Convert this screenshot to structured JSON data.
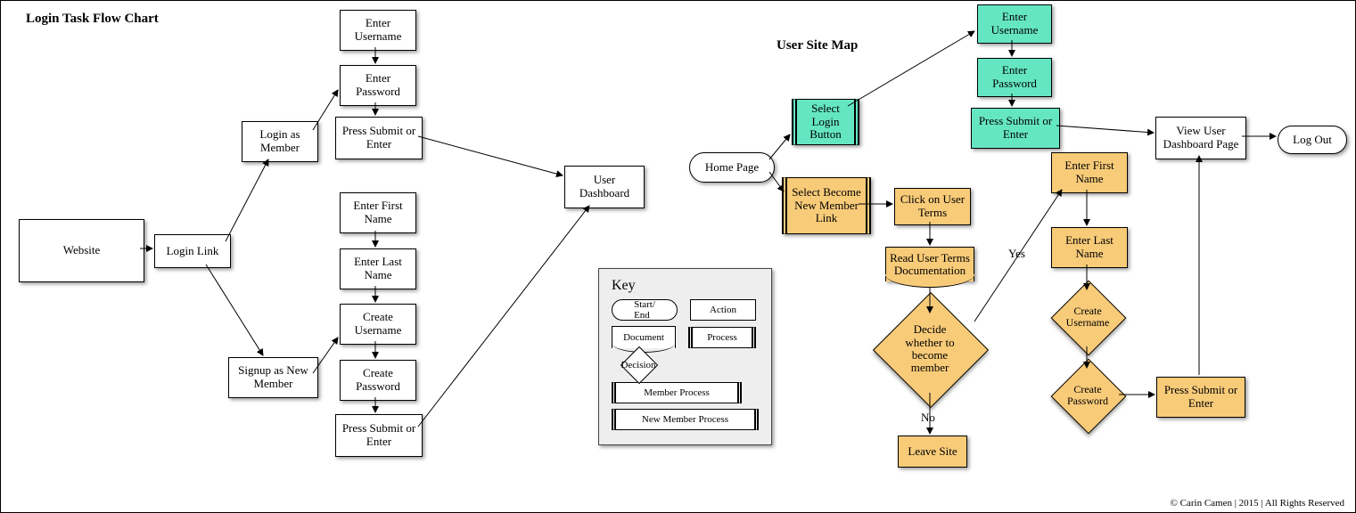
{
  "titles": {
    "left": "Login Task Flow Chart",
    "right": "User Site Map"
  },
  "key": {
    "header": "Key",
    "start_end": "Start/\nEnd",
    "action": "Action",
    "document": "Document",
    "process": "Process",
    "decision": "Decision",
    "member_process": "Member Process",
    "new_member_process": "New Member Process"
  },
  "left": {
    "website": "Website",
    "login_link": "Login Link",
    "login_member": "Login as Member",
    "signup_new": "Signup as New Member",
    "enter_username": "Enter Username",
    "enter_password": "Enter Password",
    "press_submit1": "Press Submit or Enter",
    "enter_first": "Enter First Name",
    "enter_last": "Enter Last Name",
    "create_user": "Create Username",
    "create_pass": "Create Password",
    "press_submit2": "Press Submit or Enter",
    "user_dashboard": "User Dashboard"
  },
  "right": {
    "home": "Home Page",
    "select_login": "Select Login Button",
    "enter_username": "Enter Username",
    "enter_password": "Enter Password",
    "press_submit": "Press Submit or Enter",
    "select_new": "Select Become New Member Link",
    "click_terms": "Click on User Terms",
    "read_terms": "Read User Terms Documentation",
    "decide": "Decide whether to become member",
    "yes": "Yes",
    "no": "No",
    "leave": "Leave Site",
    "enter_first": "Enter First Name",
    "enter_last": "Enter Last Name",
    "create_user": "Create Username",
    "create_pass": "Create Password",
    "press_submit2": "Press Submit or Enter",
    "view_dash": "View User Dashboard Page",
    "logout": "Log Out"
  },
  "copyright": "© Carin Camen | 2015 | All Rights Reserved"
}
